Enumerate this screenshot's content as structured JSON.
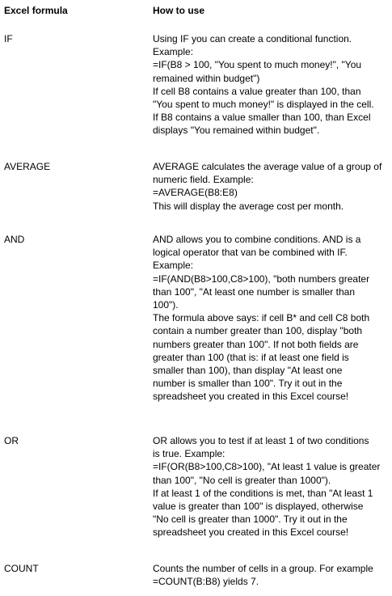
{
  "header": {
    "formula_label": "Excel formula",
    "usage_label": "How to use"
  },
  "rows": [
    {
      "name": "IF",
      "lines": [
        "Using IF you can create a conditional function.",
        "Example:",
        "=IF(B8 > 100, \"You spent to much money!\", \"You",
        "remained within budget\")",
        "If cell B8 contains a value greater than 100, than",
        "\"You spent to much money!\" is displayed in the cell.",
        "If B8 contains a value smaller than 100, than Excel",
        "displays \"You remained within budget\"."
      ]
    },
    {
      "name": "AVERAGE",
      "lines": [
        "AVERAGE calculates the average value of a group of",
        "numeric field. Example:",
        "=AVERAGE(B8:E8)",
        "This will display the average cost per month."
      ]
    },
    {
      "name": "AND",
      "lines": [
        "AND allows you to combine conditions. AND is a",
        "logical operator that van be combined with IF.",
        "Example:",
        "=IF(AND(B8>100,C8>100), \"both numbers greater",
        "than 100\", \"At least one number is smaller than",
        "100\").",
        "The formula above says: if cell B* and cell C8 both",
        "contain a number greater than 100, display \"both",
        "numbers greater than 100\". If not both fields are",
        "greater than 100 (that is: if at least one field is",
        "smaller than 100), than display \"At least one",
        "number is smaller than 100\". Try it out in the",
        "spreadsheet you created in this Excel course!"
      ]
    },
    {
      "name": "OR",
      "lines": [
        "OR allows you to test if at least 1 of two conditions",
        "is true. Example:",
        "=IF(OR(B8>100,C8>100), \"At least 1 value is greater",
        "than 100\", \"No cell is greater than 1000\").",
        "If at least 1 of the conditions is met, than \"At least 1",
        "value is greater than 100\" is displayed, otherwise",
        "\"No cell is greater than 1000\". Try it out in the",
        "spreadsheet you created in this Excel course!"
      ]
    },
    {
      "name": "COUNT",
      "lines": [
        "Counts the number of cells in a group. For example",
        "=COUNT(B:B8) yields 7."
      ]
    }
  ]
}
